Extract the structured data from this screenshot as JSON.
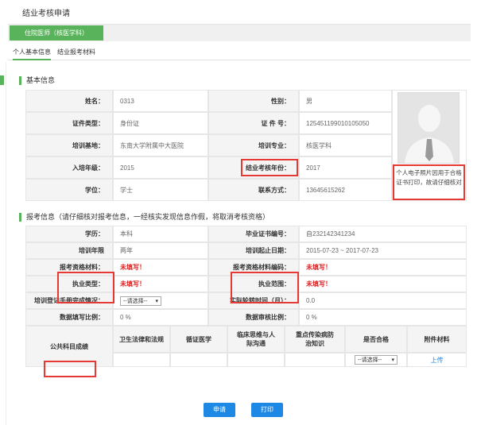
{
  "header": {
    "title": "结业考核申请",
    "green_tab": "住院医师（核医学科）"
  },
  "tabs": [
    {
      "label": "个人基本信息",
      "active": true
    },
    {
      "label": "结业报考材料",
      "active": false
    }
  ],
  "basic": {
    "section": "基本信息",
    "rows": [
      {
        "l1": "姓名：",
        "v1": "0313",
        "l2": "性别：",
        "v2": "男"
      },
      {
        "l1": "证件类型：",
        "v1": "身份证",
        "l2": "证 件 号：",
        "v2": "125451199010105050"
      },
      {
        "l1": "培训基地：",
        "v1": "东南大学附属中大医院",
        "l2": "培训专业：",
        "v2": "核医学科"
      },
      {
        "l1": "入培年级：",
        "v1": "2015",
        "l2": "结业考核年份：",
        "v2": "2017"
      },
      {
        "l1": "学位：",
        "v1": "学士",
        "l2": "联系方式：",
        "v2": "13645615262"
      }
    ],
    "photo_note": "个人电子照片因用于合格证书打印，故请仔细核对"
  },
  "exam": {
    "section": "报考信息（请仔细核对报考信息，一经核实发现信息作假，将取消考核资格）",
    "rows": [
      {
        "l1": "学历：",
        "v1": "本科",
        "l2": "毕业证书编号：",
        "v2": "自232142341234"
      },
      {
        "l1": "培训年限",
        "v1": "两年",
        "l2": "培训起止日期：",
        "v2": "2015-07-23 ~ 2017-07-23"
      },
      {
        "l1": "报考资格材料：",
        "v1": "未填写！",
        "l2": "报考资格材料编码：",
        "v2": "未填写！"
      },
      {
        "l1": "执业类型：",
        "v1": "未填写！",
        "l2": "执业范围：",
        "v2": "未填写！"
      },
      {
        "l1": "培训登记手册完成情况：",
        "v1": "--请选择--",
        "l2": "实际轮转时间（月）：",
        "v2": "0.0"
      },
      {
        "l1": "数据填写比例：",
        "v1": "0 %",
        "l2": "数据审核比例：",
        "v2": "0 %"
      }
    ]
  },
  "public_subjects": {
    "label": "公共科目成绩",
    "columns": [
      "卫生法律和法规",
      "循证医学",
      "临床思维与人际沟通",
      "重点传染病防治知识",
      "是否合格",
      "附件材料"
    ],
    "select": "--请选择--",
    "upload": "上传"
  },
  "buttons": {
    "apply": "申请",
    "print": "打印"
  },
  "colors": {
    "accent": "#58b35b",
    "highlight": "#e53935",
    "button": "#1e88e5"
  }
}
